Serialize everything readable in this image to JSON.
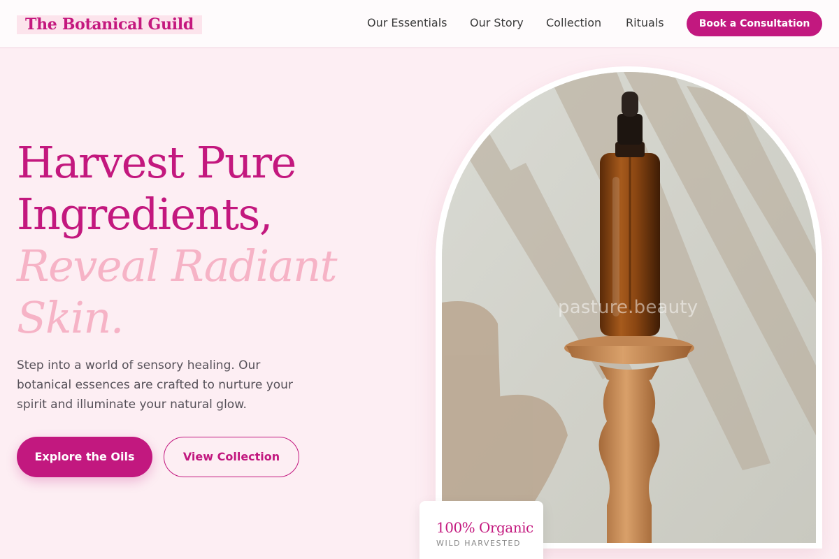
{
  "brand": {
    "name": "The Botanical Guild"
  },
  "nav": {
    "items": [
      {
        "label": "Our Essentials"
      },
      {
        "label": "Our Story"
      },
      {
        "label": "Collection"
      },
      {
        "label": "Rituals"
      }
    ],
    "cta_label": "Book a Consultation"
  },
  "hero": {
    "headline_line1": "Harvest Pure",
    "headline_line2": "Ingredients,",
    "headline_line3": "Reveal Radiant",
    "headline_line4": "Skin.",
    "lead": "Step into a world of sensory healing. Our botanical essences are crafted to nurture your spirit and illuminate your natural glow.",
    "primary_button": "Explore the Oils",
    "secondary_button": "View Collection"
  },
  "image": {
    "watermark": "pasture.beauty"
  },
  "badge": {
    "title": "100% Organic",
    "subtitle": "WILD HARVESTED"
  },
  "colors": {
    "accent": "#c2187f",
    "accent_soft": "#f6b3c6",
    "page_bg": "#fdeef3",
    "header_bg": "#fefbfc"
  }
}
